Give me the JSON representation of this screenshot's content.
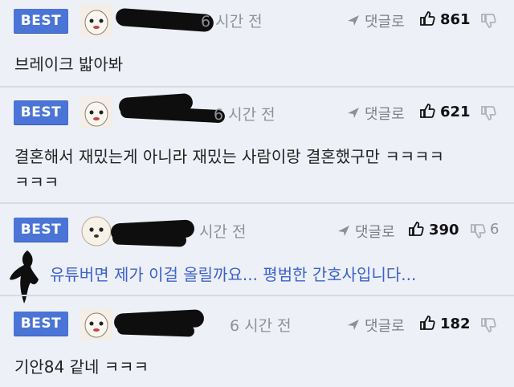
{
  "comments": [
    {
      "badge": "BEST",
      "time": "6 시간 전",
      "reply_label": "댓글로",
      "likes": "861",
      "dislikes": "",
      "text": "브레이크 밟아봐"
    },
    {
      "badge": "BEST",
      "time": "6 시간 전",
      "reply_label": "댓글로",
      "likes": "621",
      "dislikes": "",
      "text_line1": "결혼해서 재밌는게 아니라 재밌는 사람이랑 결혼했구만 ㅋㅋㅋㅋ",
      "text_line2": "ㅋㅋㅋ"
    },
    {
      "badge": "BEST",
      "time": "시간 전",
      "reply_label": "댓글로",
      "likes": "390",
      "dislikes": "6",
      "text": "유튜버면 제가 이걸 올릴까요... 평범한 간호사입니다..."
    },
    {
      "badge": "BEST",
      "time": "6 시간 전",
      "reply_label": "댓글로",
      "likes": "182",
      "dislikes": "",
      "text": "기안84 같네 ㅋㅋㅋ"
    }
  ],
  "icons": {
    "reply": "reply-arrow-icon",
    "like": "thumbs-up-icon",
    "dislike": "thumbs-down-icon"
  },
  "colors": {
    "badge": "#4a74d6",
    "background": "#eef0f7",
    "link": "#3a62c9"
  }
}
